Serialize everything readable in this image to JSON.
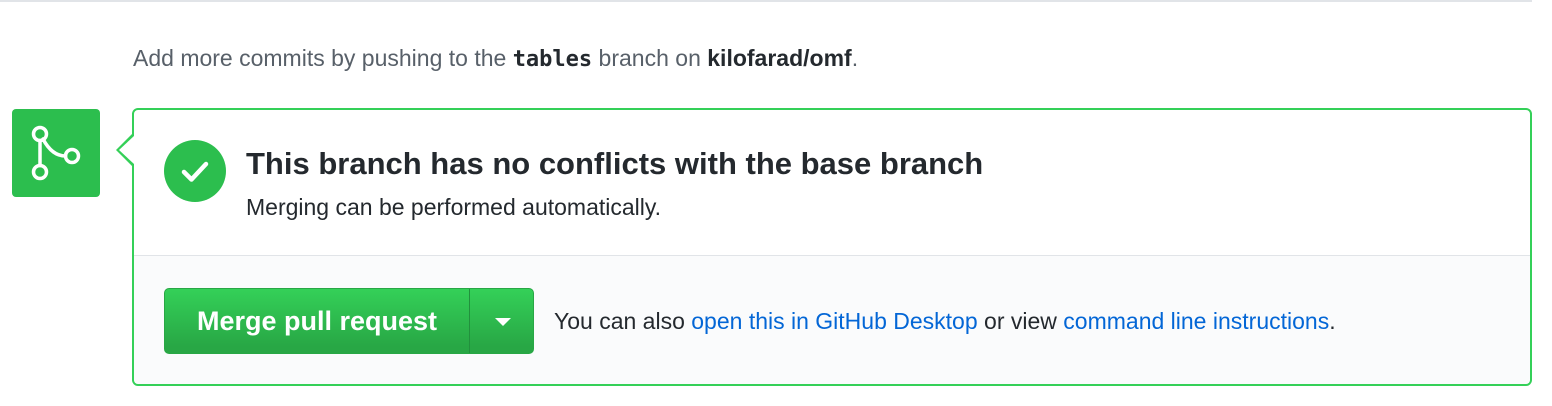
{
  "timeline_hint": {
    "prefix": "Add more commits by pushing to the ",
    "branch": "tables",
    "middle": " branch on ",
    "repo": "kilofarad/omf",
    "suffix": "."
  },
  "merge_status": {
    "icon": "git-merge-icon",
    "check_icon": "check-icon",
    "title": "This branch has no conflicts with the base branch",
    "subtitle": "Merging can be performed automatically."
  },
  "merge_actions": {
    "merge_button_label": "Merge pull request",
    "dropdown_icon": "triangle-down-icon",
    "alt_prefix": "You can also ",
    "desktop_link": "open this in GitHub Desktop",
    "alt_middle": " or view ",
    "cli_link": "command line instructions",
    "alt_suffix": "."
  },
  "colors": {
    "success_green": "#2cbe4e",
    "border_green": "#34d058",
    "link_blue": "#0366d6",
    "muted_text": "#586069"
  }
}
